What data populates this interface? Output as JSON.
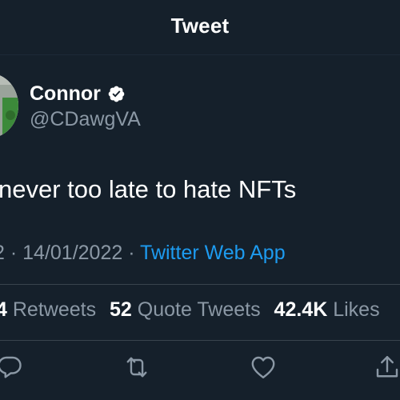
{
  "header": {
    "title": "Tweet"
  },
  "author": {
    "display_name": "Connor",
    "handle": "@CDawgVA",
    "verified": true
  },
  "tweet": {
    "text": "never too late to hate NFTs",
    "time_partial": "2",
    "separator": "·",
    "date": "14/01/2022",
    "source": "Twitter Web App"
  },
  "stats": {
    "retweets_count": "4",
    "retweets_label": "Retweets",
    "quote_count": "52",
    "quote_label": "Quote Tweets",
    "likes_count": "42.4K",
    "likes_label": "Likes"
  },
  "actions": [
    "reply-icon",
    "retweet-icon",
    "like-icon",
    "share-icon"
  ],
  "colors": {
    "background": "#15202b",
    "text": "#ffffff",
    "muted": "#8b98a5",
    "link": "#1d9bf0",
    "divider": "#38444d"
  }
}
